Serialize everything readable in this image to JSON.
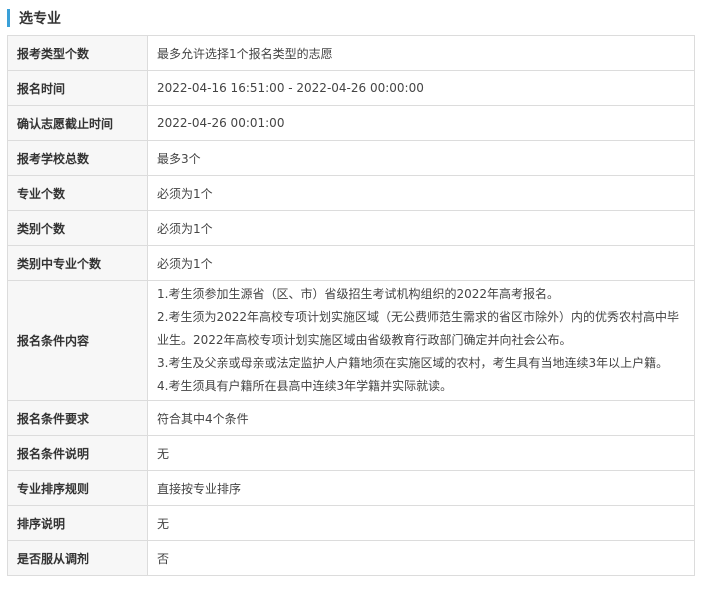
{
  "section": {
    "title": "选专业"
  },
  "accent_color": "#3aa0d8",
  "rows": [
    {
      "label": "报考类型个数",
      "value": "最多允许选择1个报名类型的志愿"
    },
    {
      "label": "报名时间",
      "value": "2022-04-16 16:51:00 - 2022-04-26 00:00:00"
    },
    {
      "label": "确认志愿截止时间",
      "value": "2022-04-26 00:01:00"
    },
    {
      "label": "报考学校总数",
      "value": "最多3个"
    },
    {
      "label": "专业个数",
      "value": "必须为1个"
    },
    {
      "label": "类别个数",
      "value": "必须为1个"
    },
    {
      "label": "类别中专业个数",
      "value": "必须为1个"
    }
  ],
  "conditions": {
    "label": "报名条件内容",
    "lines": [
      "1.考生须参加生源省（区、市）省级招生考试机构组织的2022年高考报名。",
      "2.考生须为2022年高校专项计划实施区域（无公费师范生需求的省区市除外）内的优秀农村高中毕业生。2022年高校专项计划实施区域由省级教育行政部门确定并向社会公布。",
      "3.考生及父亲或母亲或法定监护人户籍地须在实施区域的农村，考生具有当地连续3年以上户籍。",
      "4.考生须具有户籍所在县高中连续3年学籍并实际就读。"
    ]
  },
  "rows_after": [
    {
      "label": "报名条件要求",
      "value": "符合其中4个条件"
    },
    {
      "label": "报名条件说明",
      "value": "无"
    },
    {
      "label": "专业排序规则",
      "value": "直接按专业排序"
    },
    {
      "label": "排序说明",
      "value": "无"
    },
    {
      "label": "是否服从调剂",
      "value": "否"
    }
  ]
}
